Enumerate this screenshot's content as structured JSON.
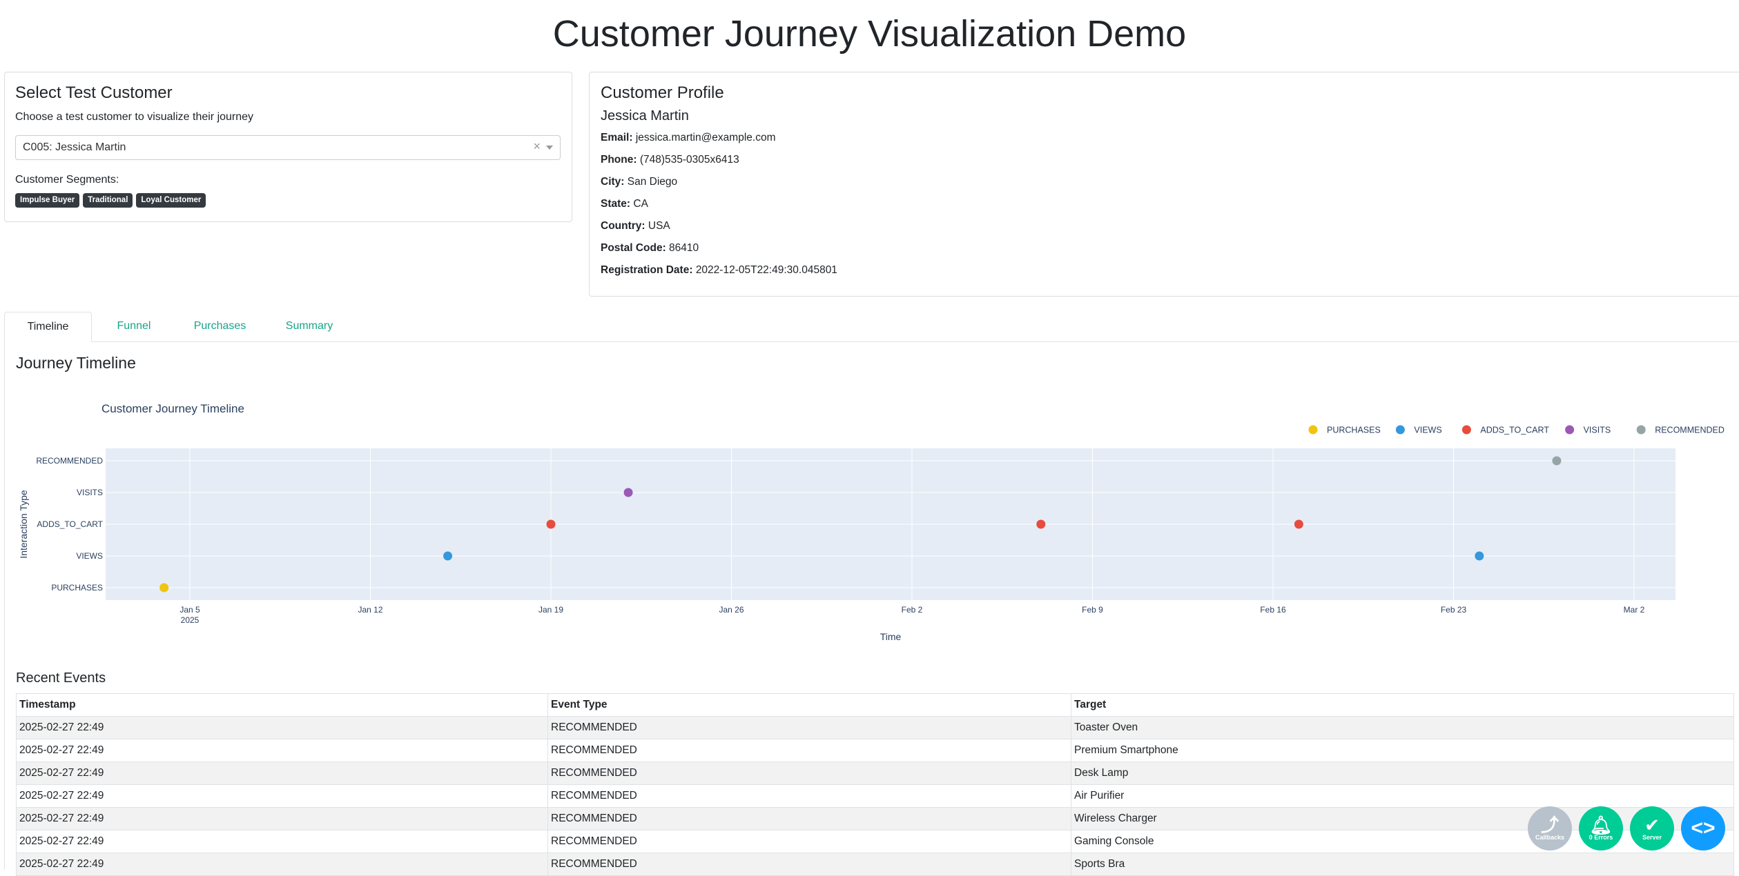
{
  "page": {
    "title": "Customer Journey Visualization Demo"
  },
  "select": {
    "title": "Select Test Customer",
    "subtitle": "Choose a test customer to visualize their journey",
    "selected": "C005: Jessica Martin",
    "clear_glyph": "×",
    "segments_label": "Customer Segments:",
    "segments": [
      "Impulse Buyer",
      "Traditional",
      "Loyal Customer"
    ]
  },
  "profile": {
    "title": "Customer Profile",
    "name": "Jessica Martin",
    "fields": [
      {
        "label": "Email:",
        "value": "jessica.martin@example.com"
      },
      {
        "label": "Phone:",
        "value": "(748)535-0305x6413"
      },
      {
        "label": "City:",
        "value": "San Diego"
      },
      {
        "label": "State:",
        "value": "CA"
      },
      {
        "label": "Country:",
        "value": "USA"
      },
      {
        "label": "Postal Code:",
        "value": "86410"
      },
      {
        "label": "Registration Date:",
        "value": "2022-12-05T22:49:30.045801"
      }
    ]
  },
  "tabs": [
    "Timeline",
    "Funnel",
    "Purchases",
    "Summary"
  ],
  "active_tab": "Timeline",
  "timeline": {
    "heading": "Journey Timeline"
  },
  "chart_data": {
    "type": "scatter",
    "title": "Customer Journey Timeline",
    "xlabel": "Time",
    "ylabel": "Interaction Type",
    "categories": [
      "PURCHASES",
      "VIEWS",
      "ADDS_TO_CART",
      "VISITS",
      "RECOMMENDED"
    ],
    "x_ticks": [
      "Jan 5",
      "Jan 12",
      "Jan 19",
      "Jan 26",
      "Feb 2",
      "Feb 9",
      "Feb 16",
      "Feb 23",
      "Mar 2"
    ],
    "x_tick_sub": "2025",
    "xlim": [
      "2025-01-04",
      "2025-03-04"
    ],
    "grid": true,
    "legend_position": "top-right",
    "series": [
      {
        "name": "PURCHASES",
        "color": "#f1c40f",
        "points": [
          {
            "x": "2025-01-04",
            "y": "PURCHASES"
          }
        ]
      },
      {
        "name": "VIEWS",
        "color": "#3498db",
        "points": [
          {
            "x": "2025-01-15",
            "y": "VIEWS"
          },
          {
            "x": "2025-02-24",
            "y": "VIEWS"
          }
        ]
      },
      {
        "name": "ADDS_TO_CART",
        "color": "#e74c3c",
        "points": [
          {
            "x": "2025-01-19",
            "y": "ADDS_TO_CART"
          },
          {
            "x": "2025-02-07",
            "y": "ADDS_TO_CART"
          },
          {
            "x": "2025-02-17",
            "y": "ADDS_TO_CART"
          }
        ]
      },
      {
        "name": "VISITS",
        "color": "#9b59b6",
        "points": [
          {
            "x": "2025-01-22",
            "y": "VISITS"
          }
        ]
      },
      {
        "name": "RECOMMENDED",
        "color": "#95a5a6",
        "points": [
          {
            "x": "2025-02-27",
            "y": "RECOMMENDED"
          }
        ]
      }
    ]
  },
  "events": {
    "title": "Recent Events",
    "columns": [
      "Timestamp",
      "Event Type",
      "Target"
    ],
    "rows": [
      [
        "2025-02-27 22:49",
        "RECOMMENDED",
        "Toaster Oven"
      ],
      [
        "2025-02-27 22:49",
        "RECOMMENDED",
        "Premium Smartphone"
      ],
      [
        "2025-02-27 22:49",
        "RECOMMENDED",
        "Desk Lamp"
      ],
      [
        "2025-02-27 22:49",
        "RECOMMENDED",
        "Air Purifier"
      ],
      [
        "2025-02-27 22:49",
        "RECOMMENDED",
        "Wireless Charger"
      ],
      [
        "2025-02-27 22:49",
        "RECOMMENDED",
        "Gaming Console"
      ],
      [
        "2025-02-27 22:49",
        "RECOMMENDED",
        "Sports Bra"
      ]
    ]
  },
  "debug": {
    "callbacks_label": "Callbacks",
    "errors_label": "0 Errors",
    "server_label": "Server",
    "callbacks_color": "#b8c2cc",
    "errors_color": "#00cc96",
    "server_color": "#00cc96",
    "toggle_color": "#119dff"
  }
}
